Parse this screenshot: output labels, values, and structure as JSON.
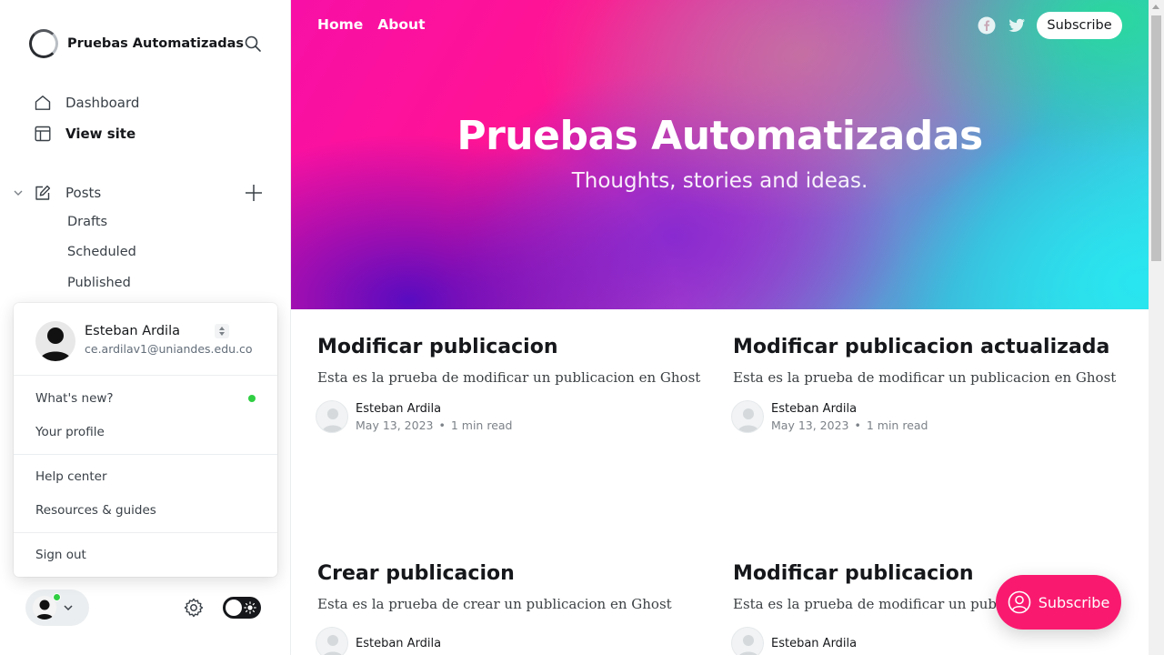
{
  "sidebar": {
    "site_title": "Pruebas Automatizadas",
    "nav": {
      "dashboard": "Dashboard",
      "view_site": "View site",
      "posts": "Posts",
      "drafts": "Drafts",
      "scheduled": "Scheduled",
      "published": "Published"
    },
    "icons": [
      "search-icon",
      "home-icon",
      "layout-icon",
      "edit-icon",
      "plus-icon",
      "chevron-down-icon",
      "gear-icon",
      "sun-icon"
    ]
  },
  "user_menu": {
    "name": "Esteban Ardila",
    "email": "ce.ardilav1@uniandes.edu.co",
    "items": {
      "whats_new": "What's new?",
      "your_profile": "Your profile",
      "help_center": "Help center",
      "resources": "Resources & guides",
      "sign_out": "Sign out"
    },
    "notification_color": "#30cf43"
  },
  "site": {
    "nav": {
      "home": "Home",
      "about": "About"
    },
    "subscribe": "Subscribe",
    "title": "Pruebas Automatizadas",
    "description": "Thoughts, stories and ideas.",
    "posts": [
      {
        "title": "Modificar publicacion",
        "excerpt": "Esta es la prueba de modificar un publicacion en Ghost",
        "author": "Esteban Ardila",
        "date": "May 13, 2023",
        "reading_time": "1 min read"
      },
      {
        "title": "Modificar publicacion actualizada",
        "excerpt": "Esta es la prueba de modificar un publicacion en Ghost",
        "author": "Esteban Ardila",
        "date": "May 13, 2023",
        "reading_time": "1 min read"
      },
      {
        "title": "Crear publicacion",
        "excerpt": "Esta es la prueba de crear un publicacion en Ghost",
        "author": "Esteban Ardila",
        "date": "",
        "reading_time": ""
      },
      {
        "title": "Modificar publicacion",
        "excerpt": "Esta es la prueba de modificar un publica",
        "author": "Esteban Ardila",
        "date": "",
        "reading_time": ""
      }
    ],
    "portal_button": "Subscribe",
    "accent_color": "#f91a6f"
  }
}
